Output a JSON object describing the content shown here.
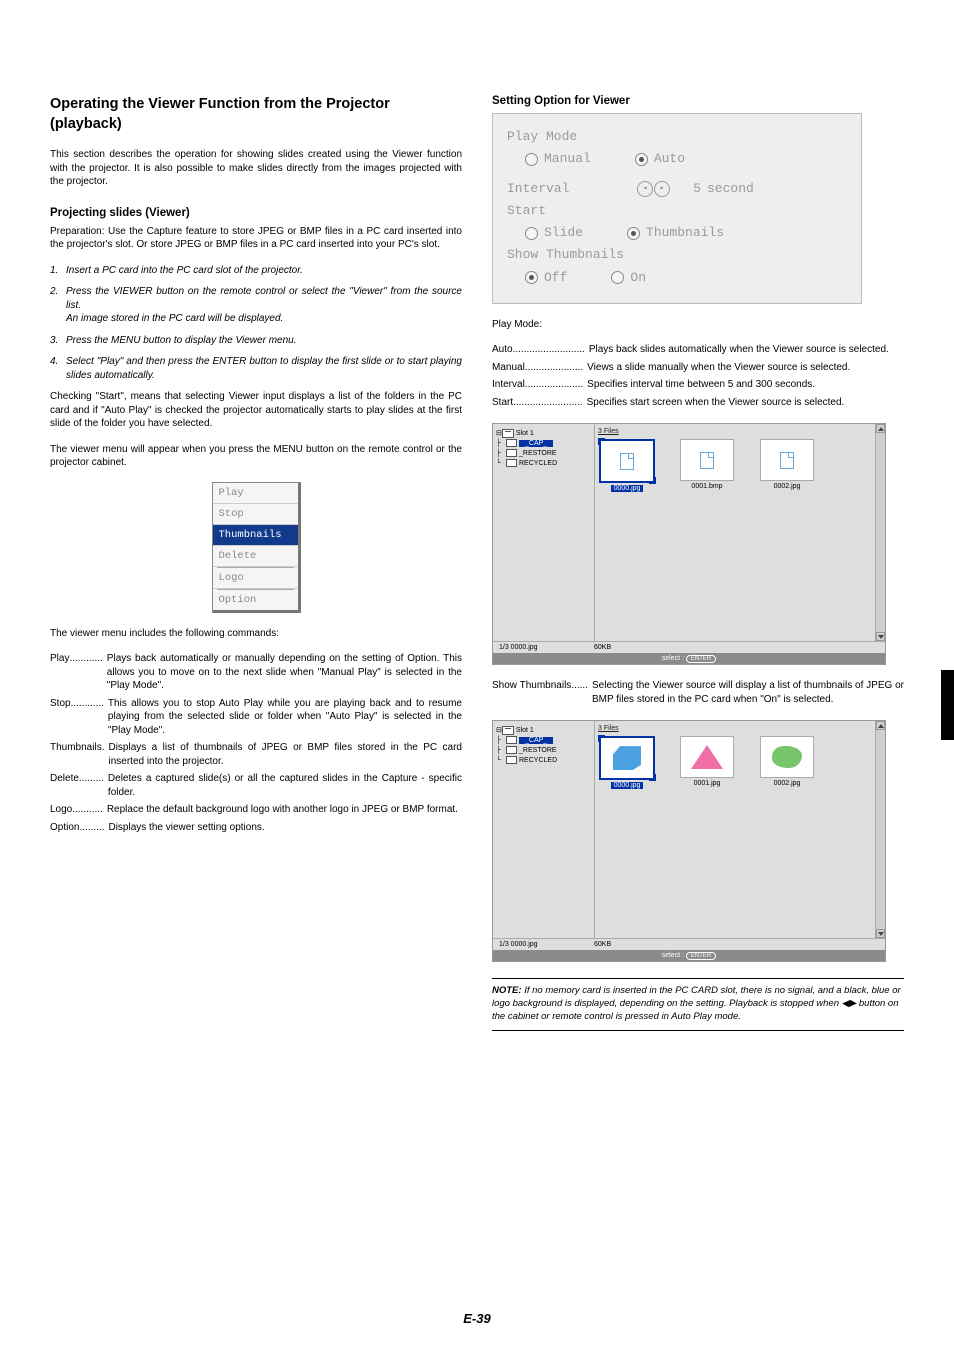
{
  "page_number": "E-39",
  "left": {
    "heading": "Operating the Viewer Function from the Projector (playback)",
    "intro": "This section describes the operation for showing slides created using the Viewer function with the projector. It is also possible to make slides directly from the images projected with the projector.",
    "sub1": "Projecting slides (Viewer)",
    "prep": "Preparation: Use the Capture feature to store JPEG or BMP files in a PC card inserted into the projector's slot. Or store JPEG or BMP files in a PC card inserted into your PC's slot.",
    "steps": [
      "Insert a PC card into the PC card slot of the projector.",
      "Press the VIEWER button on the remote control or select the \"Viewer\" from the source list.",
      "Press the MENU button to display the Viewer menu.",
      "Select \"Play\" and then press the ENTER button to display the first slide or to start playing slides automatically."
    ],
    "step2b": "An image stored in the PC card will be displayed.",
    "after_steps_1": "Checking \"Start\", means that selecting Viewer input displays a list of the folders in the PC card and if \"Auto Play\" is checked the projector automatically starts to play slides at the first slide of the folder you have selected.",
    "after_steps_2": "The viewer menu will appear when you press the MENU button on the remote control or the projector cabinet.",
    "viewer_menu": [
      "Play",
      "Stop",
      "Thumbnails",
      "Delete",
      "Logo",
      "Option"
    ],
    "commands_intro": "The viewer menu includes the following commands:",
    "commands": [
      {
        "k": "Play",
        "dots": " ............ ",
        "v": "Plays back automatically or manually depending on the setting of Option. This allows you to move on to the next slide when \"Manual Play\" is selected in the \"Play Mode\"."
      },
      {
        "k": "Stop",
        "dots": " ............ ",
        "v": "This allows you to stop Auto Play while you are playing back and to resume playing from the selected slide or folder when \"Auto Play\" is selected in the \"Play Mode\"."
      },
      {
        "k": "Thumbnails",
        "dots": " . ",
        "v": "Displays a list of thumbnails of JPEG or BMP files stored in the PC card inserted into the projector."
      },
      {
        "k": "Delete",
        "dots": " ......... ",
        "v": "Deletes a captured slide(s) or all the captured slides in the Capture - specific folder."
      },
      {
        "k": "Logo",
        "dots": " ........... ",
        "v": "Replace the default background logo with another logo in JPEG or BMP format."
      },
      {
        "k": "Option",
        "dots": " ......... ",
        "v": "Displays the viewer setting options."
      }
    ]
  },
  "right": {
    "heading": "Setting Option for Viewer",
    "panel": {
      "playmode": "Play Mode",
      "manual": "Manual",
      "auto": "Auto",
      "interval": "Interval",
      "interval_value": "5",
      "interval_unit": "second",
      "start": "Start",
      "slide": "Slide",
      "thumbs": "Thumbnails",
      "showthumbs": "Show Thumbnails",
      "off": "Off",
      "on": "On"
    },
    "playmode_label": "Play Mode:",
    "playmode_defs": [
      {
        "k": "Auto",
        "dots": " .......................... ",
        "v": "Plays back slides automatically when the Viewer source is selected."
      },
      {
        "k": "Manual",
        "dots": " ..................... ",
        "v": "Views a slide manually when the Viewer source is selected."
      },
      {
        "k": "Interval",
        "dots": " ..................... ",
        "v": "Specifies interval time between 5 and 300 seconds."
      },
      {
        "k": "Start",
        "dots": " ......................... ",
        "v": "Specifies start screen when the Viewer source is selected."
      }
    ],
    "browser": {
      "slot": "Slot 1",
      "folders": [
        "_CAP_",
        "_RESTORE",
        "RECYCLED"
      ],
      "head": "3 Files",
      "files_a": [
        "0000.jpg",
        "0001.bmp",
        "0002.jpg"
      ],
      "files_b": [
        "0000.jpg",
        "0001.jpg",
        "0002.jpg"
      ],
      "status_l": "1/3  0000.jpg",
      "status_r": "60KB",
      "footer_a": "select :",
      "footer_b": "ENTER"
    },
    "showthumbs_def": {
      "k": "Show Thumbnails",
      "dots": " ...... ",
      "v": "Selecting the Viewer source will display a list of thumbnails of JPEG or BMP files stored in the PC card when \"On\" is selected."
    },
    "note_label": "NOTE:",
    "note_text": " If no memory card is inserted in the PC CARD slot, there is no signal, and a black, blue or logo background is displayed, depending on the setting. Playback is stopped when ◀▶ button on the cabinet or remote control is pressed in Auto Play mode."
  }
}
